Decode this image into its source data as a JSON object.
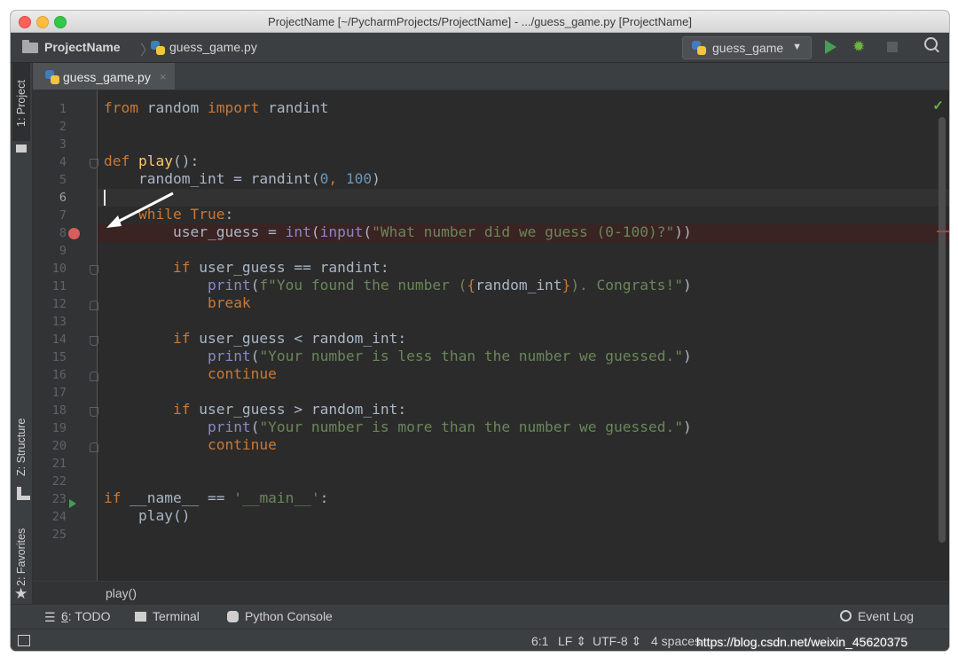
{
  "window": {
    "title": "ProjectName [~/PycharmProjects/ProjectName] - .../guess_game.py [ProjectName]"
  },
  "nav": {
    "project": "ProjectName",
    "file": "guess_game.py",
    "run_config": "guess_game"
  },
  "tabs": [
    {
      "label": "guess_game.py",
      "close": "×"
    }
  ],
  "side_tabs": {
    "project": "1: Project",
    "structure": "Z: Structure",
    "favorites": "2: Favorites"
  },
  "line_numbers": [
    "1",
    "2",
    "3",
    "4",
    "5",
    "6",
    "7",
    "8",
    "9",
    "10",
    "11",
    "12",
    "13",
    "14",
    "15",
    "16",
    "17",
    "18",
    "19",
    "20",
    "21",
    "22",
    "23",
    "24",
    "25"
  ],
  "code": {
    "l1": {
      "a": "from",
      "b": " random ",
      "c": "import",
      "d": " randint"
    },
    "l4": {
      "a": "def ",
      "b": "play",
      "c": "():"
    },
    "l5": {
      "a": "    random_int = randint(",
      "b": "0",
      "c": ", ",
      "d": "100",
      "e": ")"
    },
    "l7": {
      "a": "    while ",
      "b": "True",
      "c": ":"
    },
    "l8": {
      "a": "        user_guess = ",
      "b": "int",
      "c": "(",
      "d": "input",
      "e": "(",
      "f": "\"What number did we guess (0-100)?\"",
      "g": "))"
    },
    "l10": {
      "a": "        if ",
      "b": "user_guess == randint:"
    },
    "l11": {
      "a": "            ",
      "b": "print",
      "c": "(",
      "d": "f\"You found the number (",
      "e": "{",
      "f": "random_int",
      "g": "}",
      "h": "). Congrats!\"",
      "i": ")"
    },
    "l12": {
      "a": "            ",
      "b": "break"
    },
    "l14": {
      "a": "        if ",
      "b": "user_guess < random_int:"
    },
    "l15": {
      "a": "            ",
      "b": "print",
      "c": "(",
      "d": "\"Your number is less than the number we guessed.\"",
      "e": ")"
    },
    "l16": {
      "a": "            ",
      "b": "continue"
    },
    "l18": {
      "a": "        if ",
      "b": "user_guess > random_int:"
    },
    "l19": {
      "a": "            ",
      "b": "print",
      "c": "(",
      "d": "\"Your number is more than the number we guessed.\"",
      "e": ")"
    },
    "l20": {
      "a": "            ",
      "b": "continue"
    },
    "l23": {
      "a": "if ",
      "b": "__name__ == ",
      "c": "'__main__'",
      "d": ":"
    },
    "l24": {
      "a": "    play()"
    }
  },
  "breadcrumb": "play()",
  "tool_windows": {
    "todo_num": "6",
    "todo": ": TODO",
    "terminal": "Terminal",
    "python_console": "Python Console",
    "event_log": "Event Log"
  },
  "status": {
    "position": "6:1",
    "line_sep": "LF",
    "encoding": "UTF-8",
    "indent": "4 spaces",
    "watermark": "https://blog.csdn.net/weixin_45620375"
  },
  "colors": {
    "keyword": "#cc7832",
    "function": "#ffc66d",
    "number": "#6897bb",
    "string": "#6a8759",
    "builtin": "#8888c6",
    "breakpoint": "#db5c5c",
    "run": "#499c54"
  },
  "icons": [
    "folder-icon",
    "python-file-icon",
    "run-icon",
    "debug-icon",
    "stop-icon",
    "search-icon",
    "breakpoint-icon",
    "check-icon"
  ]
}
